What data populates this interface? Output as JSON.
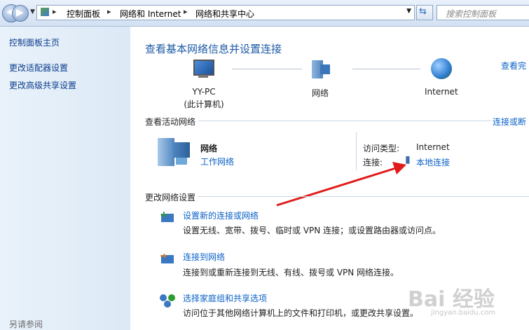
{
  "address_bar": {
    "crumbs": [
      "控制面板",
      "网络和 Internet",
      "网络和共享中心"
    ],
    "search_placeholder": "搜索控制面板"
  },
  "sidebar": {
    "items": [
      {
        "label": "控制面板主页"
      },
      {
        "label": "更改适配器设置"
      },
      {
        "label": "更改高级共享设置"
      }
    ],
    "see_also": "另请参阅"
  },
  "main": {
    "title": "查看基本网络信息并设置连接",
    "view_full_map": "查看完",
    "map": {
      "computer_name": "YY-PC",
      "computer_sub": "(此计算机)",
      "network": "网络",
      "internet": "Internet"
    },
    "active_networks_label": "查看活动网络",
    "connect_disconnect": "连接或断",
    "network_name": "网络",
    "network_type": "工作网络",
    "access_type_label": "访问类型:",
    "access_type_value": "Internet",
    "connection_label": "连接:",
    "connection_value": "本地连接",
    "change_settings_label": "更改网络设置",
    "tasks": [
      {
        "title": "设置新的连接或网络",
        "desc": "设置无线、宽带、拨号、临时或 VPN 连接；或设置路由器或访问点。"
      },
      {
        "title": "连接到网络",
        "desc": "连接到或重新连接到无线、有线、拨号或 VPN 网络连接。"
      },
      {
        "title": "选择家庭组和共享选项",
        "desc": "访问位于其他网络计算机上的文件和打印机，或更改共享设置。"
      }
    ]
  },
  "watermark": {
    "text": "Bai 经验",
    "url": "jingyan.baidu.com"
  }
}
